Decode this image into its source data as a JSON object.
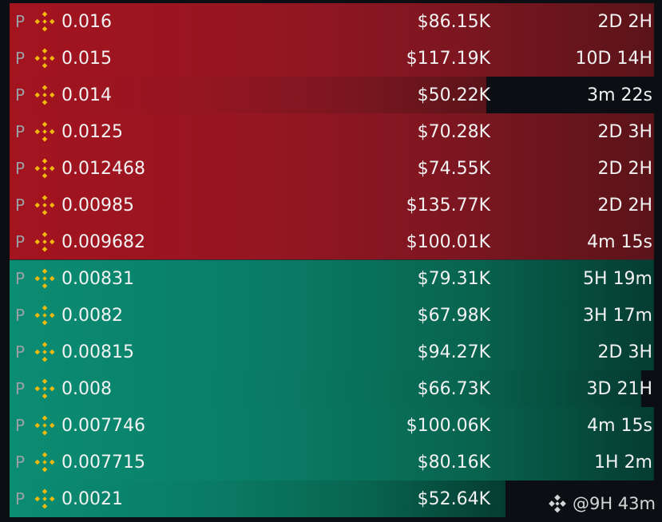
{
  "prefix": "P",
  "colors": {
    "ask": "#a3141f",
    "bid": "#0b8d73",
    "coin_icon": "#f0b90b",
    "background": "#0b0f14"
  },
  "icons": {
    "row_coin": "binance-coin-icon",
    "watermark": "binance-logo-icon"
  },
  "rows": [
    {
      "side": "ask",
      "price": "0.016",
      "amount": "$86.15K",
      "time": "2D 2H",
      "bar_fill": 1.0
    },
    {
      "side": "ask",
      "price": "0.015",
      "amount": "$117.19K",
      "time": "10D 14H",
      "bar_fill": 1.0
    },
    {
      "side": "ask",
      "price": "0.014",
      "amount": "$50.22K",
      "time": "3m 22s",
      "bar_fill": 0.74
    },
    {
      "side": "ask",
      "price": "0.0125",
      "amount": "$70.28K",
      "time": "2D 3H",
      "bar_fill": 1.0
    },
    {
      "side": "ask",
      "price": "0.012468",
      "amount": "$74.55K",
      "time": "2D 2H",
      "bar_fill": 1.0
    },
    {
      "side": "ask",
      "price": "0.00985",
      "amount": "$135.77K",
      "time": "2D 2H",
      "bar_fill": 1.0
    },
    {
      "side": "ask",
      "price": "0.009682",
      "amount": "$100.01K",
      "time": "4m 15s",
      "bar_fill": 1.0
    },
    {
      "side": "bid",
      "price": "0.00831",
      "amount": "$79.31K",
      "time": "5H 19m",
      "bar_fill": 1.0
    },
    {
      "side": "bid",
      "price": "0.0082",
      "amount": "$67.98K",
      "time": "3H 17m",
      "bar_fill": 1.0
    },
    {
      "side": "bid",
      "price": "0.00815",
      "amount": "$94.27K",
      "time": "2D 3H",
      "bar_fill": 1.0
    },
    {
      "side": "bid",
      "price": "0.008",
      "amount": "$66.73K",
      "time": "3D 21H",
      "bar_fill": 0.98
    },
    {
      "side": "bid",
      "price": "0.007746",
      "amount": "$100.06K",
      "time": "4m 15s",
      "bar_fill": 1.0
    },
    {
      "side": "bid",
      "price": "0.007715",
      "amount": "$80.16K",
      "time": "1H 2m",
      "bar_fill": 1.0
    },
    {
      "side": "bid",
      "price": "0.0021",
      "amount": "$52.64K",
      "time": "",
      "bar_fill": 0.77
    }
  ],
  "watermark": {
    "text": "@9H 43m"
  }
}
